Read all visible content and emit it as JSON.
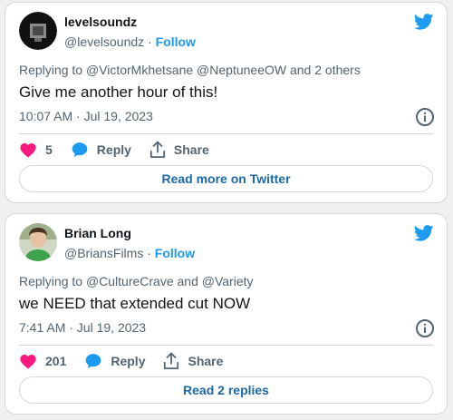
{
  "colors": {
    "accent": "#1d9bf0",
    "like": "#f91880",
    "text": "#0f1419",
    "muted": "#536471"
  },
  "tweets": [
    {
      "name": "levelsoundz",
      "handle": "@levelsoundz",
      "separator": " · ",
      "follow": "Follow",
      "replying_prefix": "Replying to ",
      "replying_to": "@VictorMkhetsane @NeptuneeOW",
      "replying_suffix": " and 2 others",
      "text": "Give me another hour of this!",
      "timestamp": "10:07 AM · Jul 19, 2023",
      "likes": "5",
      "reply_label": "Reply",
      "share_label": "Share",
      "cta": "Read more on Twitter",
      "avatar_icon": "avatar-dark-image"
    },
    {
      "name": "Brian Long",
      "handle": "@BriansFilms",
      "separator": " · ",
      "follow": "Follow",
      "replying_prefix": "Replying to ",
      "replying_to": "@CultureCrave",
      "replying_suffix": " and @Variety",
      "text": "we NEED that extended cut NOW",
      "timestamp": "7:41 AM · Jul 19, 2023",
      "likes": "201",
      "reply_label": "Reply",
      "share_label": "Share",
      "cta": "Read 2 replies",
      "avatar_icon": "avatar-person-photo"
    }
  ],
  "icons": [
    "twitter-bird-icon",
    "info-icon",
    "heart-icon",
    "reply-bubble-icon",
    "share-icon"
  ]
}
